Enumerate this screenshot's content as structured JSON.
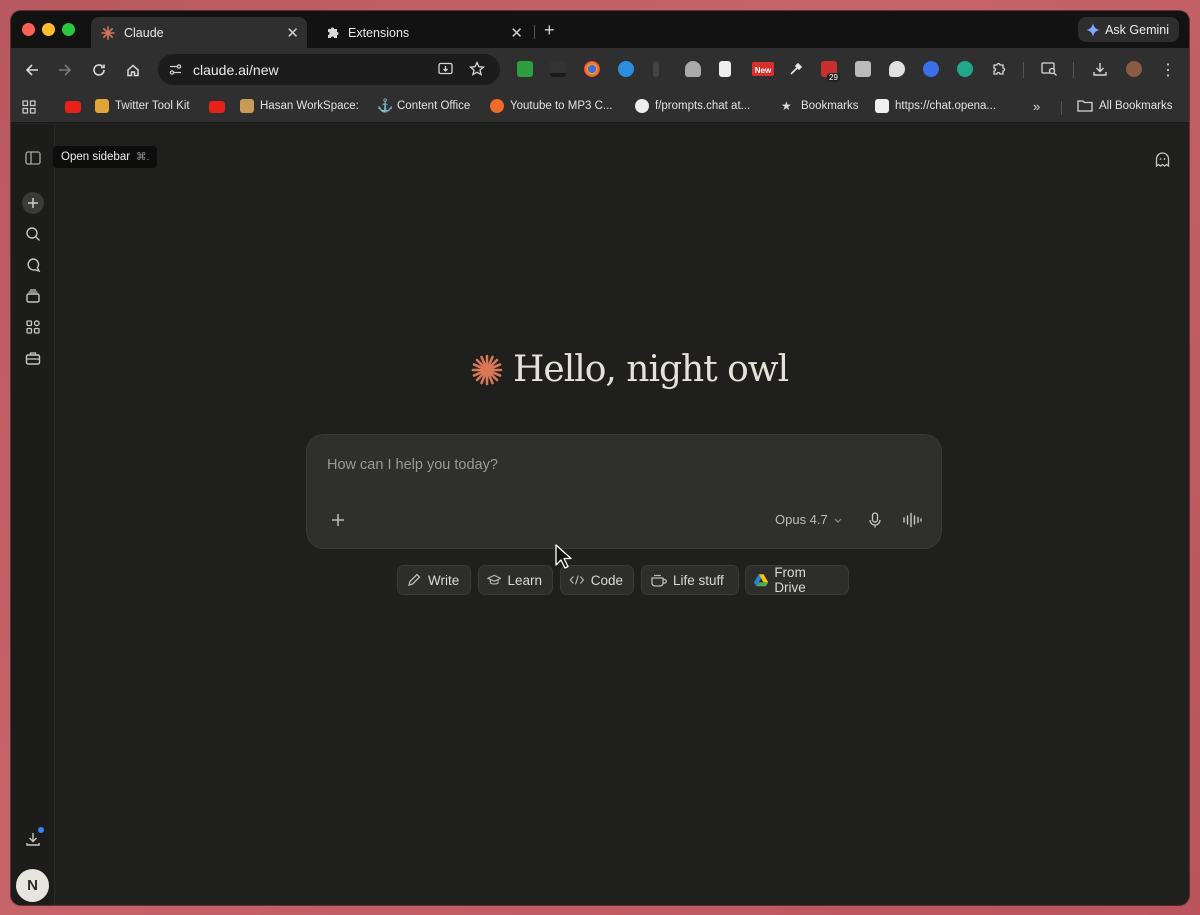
{
  "browser": {
    "tabs": [
      {
        "title": "Claude",
        "active": true
      },
      {
        "title": "Extensions",
        "active": false
      }
    ],
    "gemini_label": "Ask Gemini",
    "url": "claude.ai/new",
    "bookmarks": [
      {
        "label": "Twitter Tool Kit"
      },
      {
        "label": "Hasan WorkSpace:"
      },
      {
        "label": "Content Office"
      },
      {
        "label": "Youtube to MP3 C..."
      },
      {
        "label": "f/prompts.chat at..."
      },
      {
        "label": "Bookmarks"
      },
      {
        "label": "https://chat.opena..."
      },
      {
        "label": "All Bookmarks"
      }
    ],
    "ext_badges": {
      "new": "New",
      "count": "29"
    }
  },
  "sidebar": {
    "tooltip": "Open sidebar",
    "tooltip_shortcut": "⌘.",
    "avatar_initial": "N"
  },
  "main": {
    "greeting": "Hello, night owl",
    "placeholder": "How can I help you today?",
    "model": "Opus 4.7",
    "chips": [
      {
        "label": "Write",
        "icon": "pencil-icon"
      },
      {
        "label": "Learn",
        "icon": "graduation-cap-icon"
      },
      {
        "label": "Code",
        "icon": "code-icon"
      },
      {
        "label": "Life stuff",
        "icon": "coffee-cup-icon"
      },
      {
        "label": "From Drive",
        "icon": "google-drive-icon"
      }
    ]
  },
  "colors": {
    "accent": "#d97757",
    "background": "#1f1f1e",
    "composer": "#2f2f2d"
  }
}
